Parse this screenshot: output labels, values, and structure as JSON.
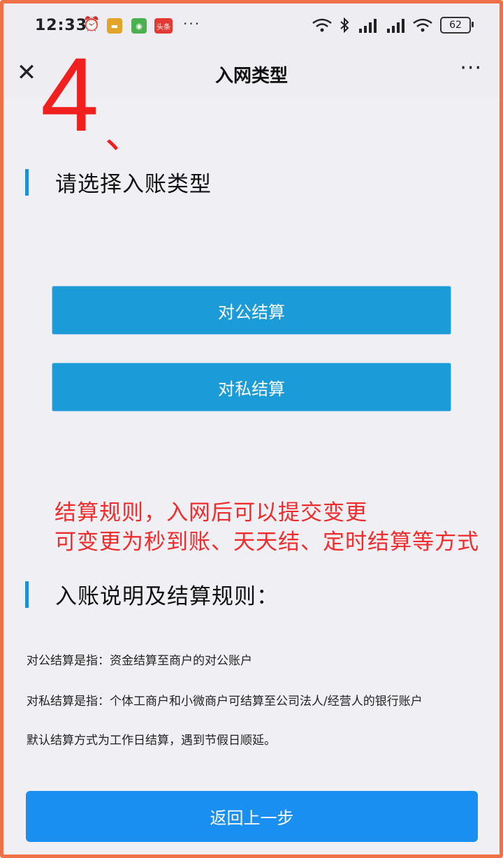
{
  "status_bar": {
    "time": "12:33",
    "app_icons": [
      "alarm-icon",
      "notes-app-icon",
      "wechat-app-icon",
      "toutiao-app-icon"
    ],
    "app3_label": "头条",
    "more": "···",
    "battery": "62"
  },
  "nav": {
    "close_glyph": "✕",
    "title": "入网类型",
    "more_glyph": "···"
  },
  "annotation": {
    "step_number": "4",
    "step_mark": "、"
  },
  "section1": {
    "title": "请选择入账类型"
  },
  "buttons": {
    "corporate": "对公结算",
    "private": "对私结算"
  },
  "note": {
    "line1": "结算规则，入网后可以提交变更",
    "line2": "可变更为秒到账、天天结、定时结算等方式"
  },
  "section2": {
    "title": "入账说明及结算规则："
  },
  "rules": [
    "对公结算是指：资金结算至商户的对公账户",
    "对私结算是指：个体工商户和小微商户可结算至公司法人/经营人的银行账户",
    "默认结算方式为工作日结算，遇到节假日顺延。"
  ],
  "back_button": "返回上一步",
  "colors": {
    "accent": "#1b9bd7",
    "back_button": "#1a8ff2",
    "annotation_red": "#f21f1f",
    "frame_orange": "#f07048"
  }
}
